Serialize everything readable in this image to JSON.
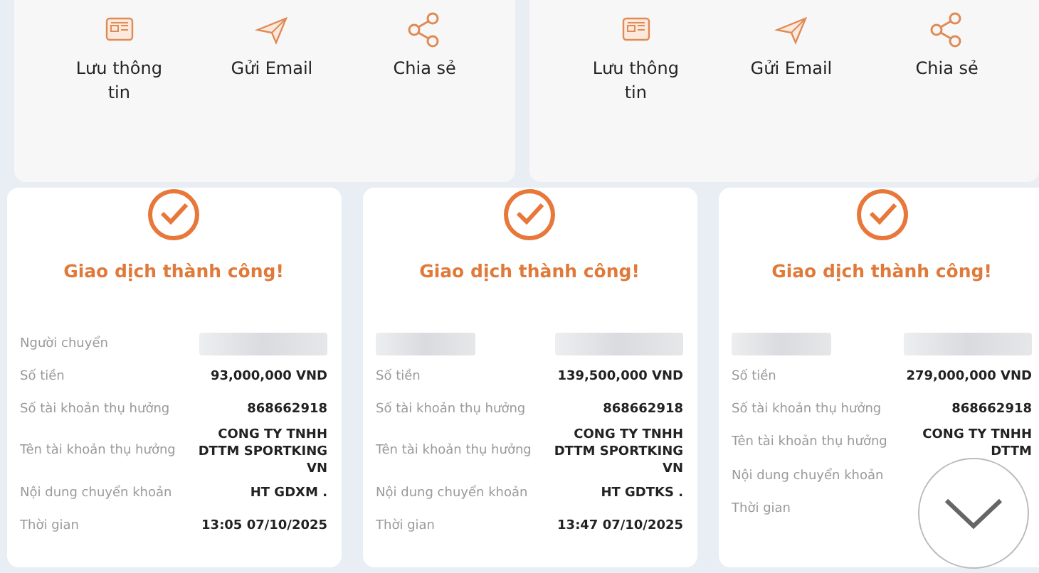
{
  "action_panels": [
    {
      "actions": [
        {
          "kind": "save",
          "label": "Lưu thông tin"
        },
        {
          "kind": "email",
          "label": "Gửi Email"
        },
        {
          "kind": "share",
          "label": "Chia sẻ"
        }
      ]
    },
    {
      "actions": [
        {
          "kind": "save",
          "label": "Lưu thông tin"
        },
        {
          "kind": "email",
          "label": "Gửi Email"
        },
        {
          "kind": "share",
          "label": "Chia sẻ"
        }
      ]
    }
  ],
  "receipts": [
    {
      "title": "Giao dịch thành công!",
      "rows": [
        {
          "kind": "redacted",
          "label": "Người chuyển"
        },
        {
          "kind": "text",
          "label": "Số tiền",
          "value": "93,000,000 VND"
        },
        {
          "kind": "text",
          "label": "Số tài khoản thụ hưởng",
          "value": "868662918"
        },
        {
          "kind": "text",
          "label": "Tên tài khoản thụ hưởng",
          "value": "CONG TY TNHH DTTM SPORTKING VN"
        },
        {
          "kind": "text",
          "label": "Nội dung chuyển khoản",
          "value": "HT GDXM ."
        },
        {
          "kind": "text",
          "label": "Thời gian",
          "value": "13:05 07/10/2025"
        }
      ]
    },
    {
      "title": "Giao dịch thành công!",
      "rows": [
        {
          "kind": "redacted"
        },
        {
          "kind": "text",
          "label": "Số tiền",
          "value": "139,500,000 VND"
        },
        {
          "kind": "text",
          "label": "Số tài khoản thụ hưởng",
          "value": "868662918"
        },
        {
          "kind": "text",
          "label": "Tên tài khoản thụ hưởng",
          "value": "CONG TY TNHH DTTM SPORTKING VN"
        },
        {
          "kind": "text",
          "label": "Nội dung chuyển khoản",
          "value": "HT GDTKS ."
        },
        {
          "kind": "text",
          "label": "Thời gian",
          "value": "13:47 07/10/2025"
        }
      ]
    },
    {
      "title": "Giao dịch thành công!",
      "rows": [
        {
          "kind": "redacted"
        },
        {
          "kind": "text",
          "label": "Số tiền",
          "value": "279,000,000 VND"
        },
        {
          "kind": "text",
          "label": "Số tài khoản thụ hưởng",
          "value": "868662918"
        },
        {
          "kind": "text",
          "label": "Tên tài khoản thụ hưởng",
          "value": "CONG TY TNHH DTTM"
        },
        {
          "kind": "text",
          "label": "Nội dung chuyển khoản"
        },
        {
          "kind": "text",
          "label": "Thời gian"
        }
      ]
    }
  ]
}
